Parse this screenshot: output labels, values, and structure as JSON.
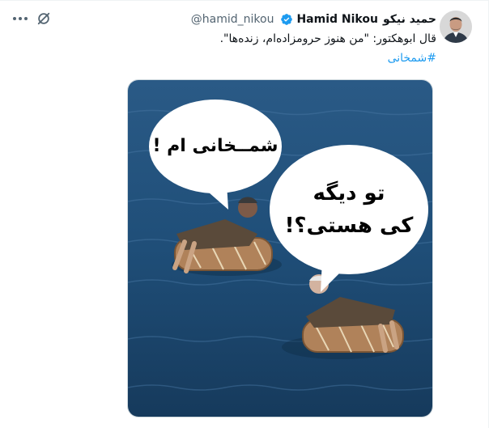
{
  "tweet": {
    "author_name_fa": "حمید نیکو",
    "author_name_en": "Hamid Nikou",
    "handle": "@hamid_nikou",
    "text": "قال ابوهکتور: \"من هنوز حرومزاده‌ام، زنده‌ها\".",
    "hashtag": "#شمخانی"
  },
  "media": {
    "bubble1": "شمــخانی ام !",
    "bubble2_line1": "تو دیگه",
    "bubble2_line2": "کی هستی؟!"
  },
  "icons": {
    "avatar": "avatar",
    "verified": "verified-badge-icon",
    "more": "more-icon",
    "grok": "grok-icon"
  },
  "colors": {
    "verified": "#1d9bf0",
    "hashtag": "#1d9bf0",
    "sea": "#1f4e78"
  }
}
